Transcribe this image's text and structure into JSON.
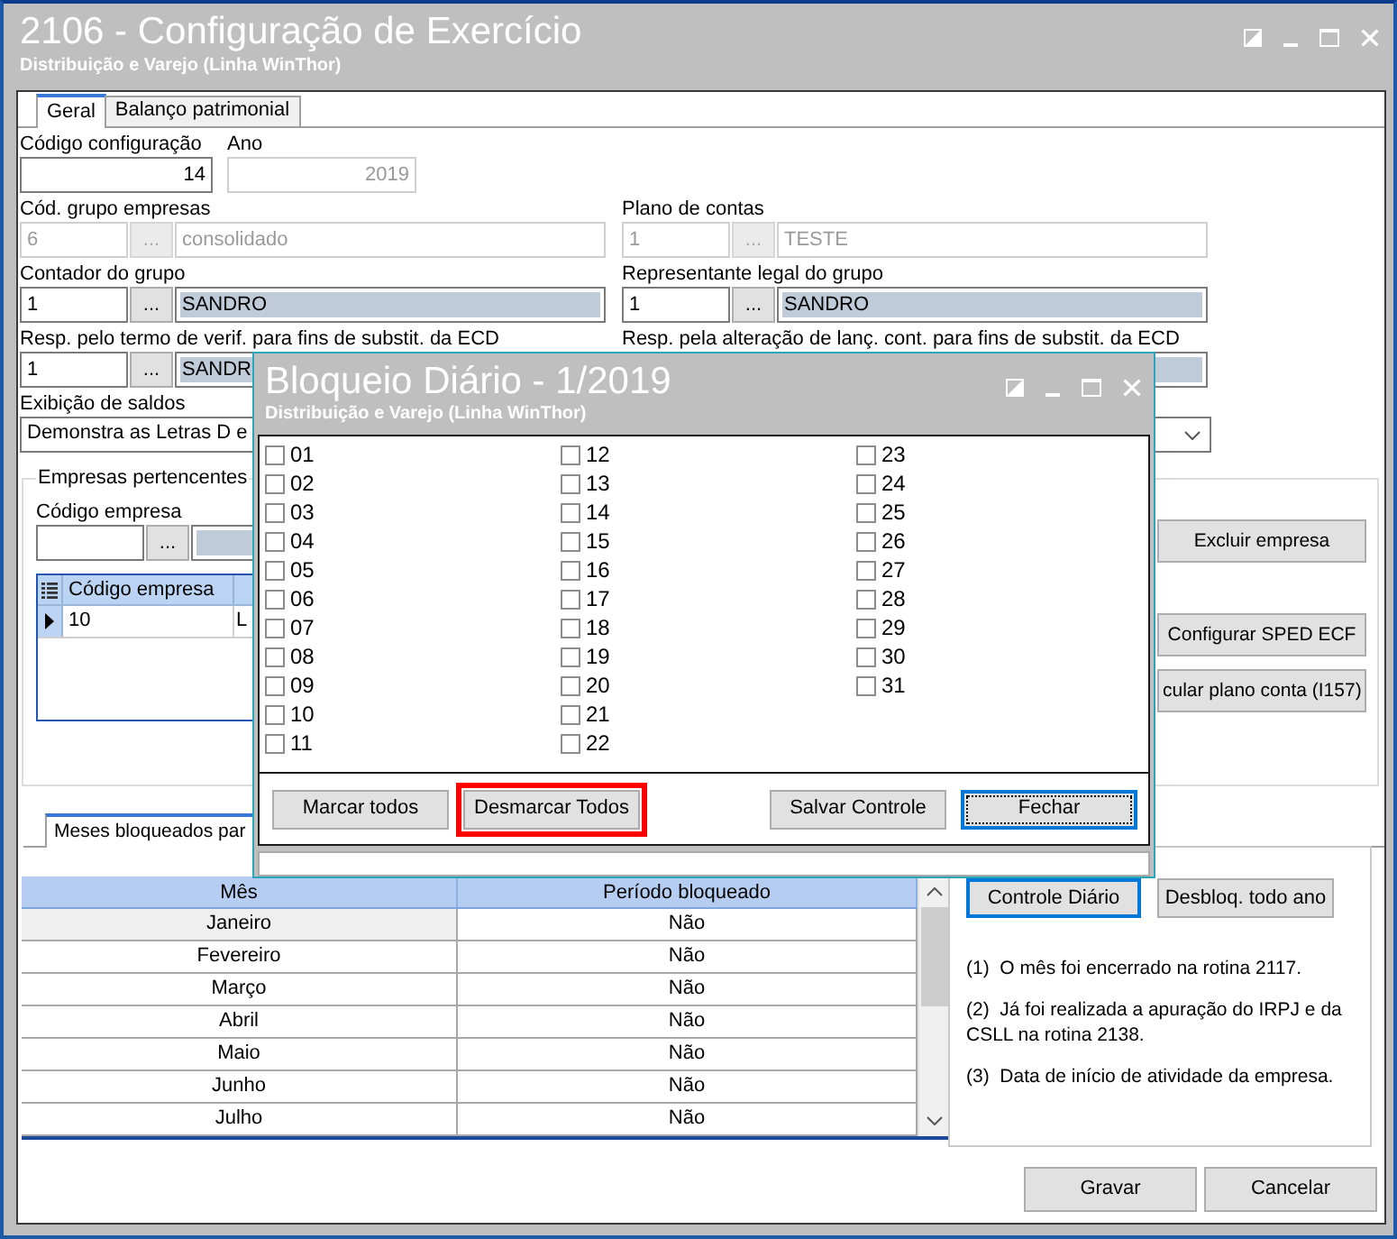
{
  "window": {
    "title": "2106 - Configuração de Exercício",
    "subtitle": "Distribuição e Varejo (Linha WinThor)"
  },
  "tabs": [
    {
      "label": "Geral",
      "selected": true
    },
    {
      "label": "Balanço patrimonial",
      "selected": false
    }
  ],
  "config_code": {
    "label": "Código configuração",
    "value": "14",
    "disabled": false
  },
  "year": {
    "label": "Ano",
    "value": "2019",
    "disabled": true
  },
  "lookups": [
    {
      "label": "Cód. grupo empresas",
      "code": "6",
      "button": "...",
      "name": "consolidado",
      "disabled": true
    },
    {
      "label": "Plano de contas",
      "code": "1",
      "button": "...",
      "name": "TESTE",
      "disabled": true
    },
    {
      "label": "Contador do grupo",
      "code": "1",
      "button": "...",
      "name": "SANDRO",
      "disabled": false
    },
    {
      "label": "Representante legal do grupo",
      "code": "1",
      "button": "...",
      "name": "SANDRO",
      "disabled": false
    },
    {
      "label": "Resp. pelo termo de verif. para fins de substit. da ECD",
      "code": "1",
      "button": "...",
      "name": "SANDR",
      "disabled": false
    },
    {
      "label": "Resp. pela alteração de lanç. cont. para fins de substit. da ECD",
      "disabled": false
    }
  ],
  "balance_display": {
    "label": "Exibição de saldos",
    "value": "Demonstra as Letras D e"
  },
  "companies": {
    "title": "Empresas pertencentes",
    "code_label": "Código empresa",
    "button": "...",
    "grid": {
      "columns": [
        "Código empresa"
      ],
      "rows": [
        {
          "cells": [
            "10",
            "L"
          ],
          "current": true
        }
      ]
    },
    "buttons": [
      "Excluir empresa",
      "Configurar SPED ECF",
      "cular plano conta (I157)"
    ]
  },
  "months_tabs": [
    {
      "label": "Meses bloqueados par",
      "selected": true
    }
  ],
  "months_table": {
    "columns": [
      "Mês",
      "Período bloqueado"
    ],
    "rows": [
      {
        "month": "Janeiro",
        "blocked": "Não",
        "selected": true
      },
      {
        "month": "Fevereiro",
        "blocked": "Não",
        "selected": false
      },
      {
        "month": "Março",
        "blocked": "Não",
        "selected": false
      },
      {
        "month": "Abril",
        "blocked": "Não",
        "selected": false
      },
      {
        "month": "Maio",
        "blocked": "Não",
        "selected": false
      },
      {
        "month": "Junho",
        "blocked": "Não",
        "selected": false
      },
      {
        "month": "Julho",
        "blocked": "Não",
        "selected": false
      }
    ]
  },
  "month_buttons": [
    {
      "label": "Controle Diário",
      "focused": true
    },
    {
      "label": "Desbloq. todo ano",
      "focused": false
    }
  ],
  "notes": [
    "(1)  O mês foi encerrado na rotina 2117.",
    "(2)  Já foi realizada a apuração do IRPJ e da CSLL na rotina 2138.",
    "(3)  Data de início de atividade da empresa."
  ],
  "footer_buttons": [
    "Gravar",
    "Cancelar"
  ],
  "dialog": {
    "title": "Bloqueio Diário - 1/2019",
    "subtitle": "Distribuição e Varejo (Linha WinThor)",
    "days": [
      {
        "label": "01",
        "checked": false
      },
      {
        "label": "02",
        "checked": false
      },
      {
        "label": "03",
        "checked": false
      },
      {
        "label": "04",
        "checked": false
      },
      {
        "label": "05",
        "checked": false
      },
      {
        "label": "06",
        "checked": false
      },
      {
        "label": "07",
        "checked": false
      },
      {
        "label": "08",
        "checked": false
      },
      {
        "label": "09",
        "checked": false
      },
      {
        "label": "10",
        "checked": false
      },
      {
        "label": "11",
        "checked": false
      },
      {
        "label": "12",
        "checked": false
      },
      {
        "label": "13",
        "checked": false
      },
      {
        "label": "14",
        "checked": false
      },
      {
        "label": "15",
        "checked": false
      },
      {
        "label": "16",
        "checked": false
      },
      {
        "label": "17",
        "checked": false
      },
      {
        "label": "18",
        "checked": false
      },
      {
        "label": "19",
        "checked": false
      },
      {
        "label": "20",
        "checked": false
      },
      {
        "label": "21",
        "checked": false
      },
      {
        "label": "22",
        "checked": false
      },
      {
        "label": "23",
        "checked": false
      },
      {
        "label": "24",
        "checked": false
      },
      {
        "label": "25",
        "checked": false
      },
      {
        "label": "26",
        "checked": false
      },
      {
        "label": "27",
        "checked": false
      },
      {
        "label": "28",
        "checked": false
      },
      {
        "label": "29",
        "checked": false
      },
      {
        "label": "30",
        "checked": false
      },
      {
        "label": "31",
        "checked": false
      }
    ],
    "left_buttons": [
      {
        "label": "Marcar todos",
        "focused": false,
        "highlighted": false
      },
      {
        "label": "Desmarcar Todos",
        "focused": false,
        "highlighted": true
      }
    ],
    "right_buttons": [
      {
        "label": "Salvar Controle",
        "focused": false,
        "highlighted": false
      },
      {
        "label": "Fechar",
        "focused": true,
        "highlighted": false
      }
    ]
  }
}
